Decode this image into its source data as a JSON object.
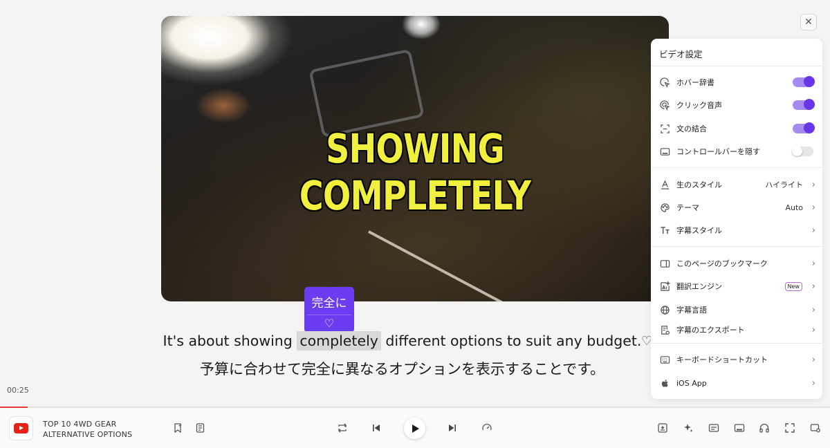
{
  "video": {
    "caption": "SHOWING COMPLETELY"
  },
  "popup": {
    "word": "完全に",
    "heart_icon": "heart-icon"
  },
  "subtitle": {
    "en_before": "It's about showing ",
    "en_highlight": "completely",
    "en_after": " different options to suit any budget.",
    "ja": "予算に合わせて完全に異なるオプションを表示することです。"
  },
  "player": {
    "time": "00:25",
    "progress_fraction": 0.033,
    "title_line1": "TOP 10 4WD GEAR",
    "title_line2": "ALTERNATIVE OPTIONS"
  },
  "settings": {
    "title": "ビデオ設定",
    "toggles": [
      {
        "label": "ホバー辞書",
        "on": true,
        "icon": "hover-cursor-icon"
      },
      {
        "label": "クリック音声",
        "on": true,
        "icon": "click-audio-icon"
      },
      {
        "label": "文の結合",
        "on": true,
        "icon": "merge-sentences-icon"
      },
      {
        "label": "コントロールバーを隠す",
        "on": false,
        "icon": "hide-bar-icon"
      }
    ],
    "style": [
      {
        "label": "生のスタイル",
        "value": "ハイライト",
        "icon": "text-style-icon"
      },
      {
        "label": "テーマ",
        "value": "Auto",
        "icon": "palette-icon"
      },
      {
        "label": "字幕スタイル",
        "value": "",
        "icon": "font-size-icon"
      }
    ],
    "more": [
      {
        "label": "このページのブックマーク",
        "icon": "bookmark-panel-icon"
      },
      {
        "label": "翻訳エンジン",
        "badge": "New",
        "icon": "ai-translate-icon"
      },
      {
        "label": "字幕言語",
        "icon": "globe-icon"
      },
      {
        "label": "字幕のエクスポート",
        "icon": "export-icon"
      }
    ],
    "extra": [
      {
        "label": "キーボードショートカット",
        "icon": "keyboard-icon"
      },
      {
        "label": "iOS App",
        "icon": "apple-icon"
      }
    ]
  }
}
